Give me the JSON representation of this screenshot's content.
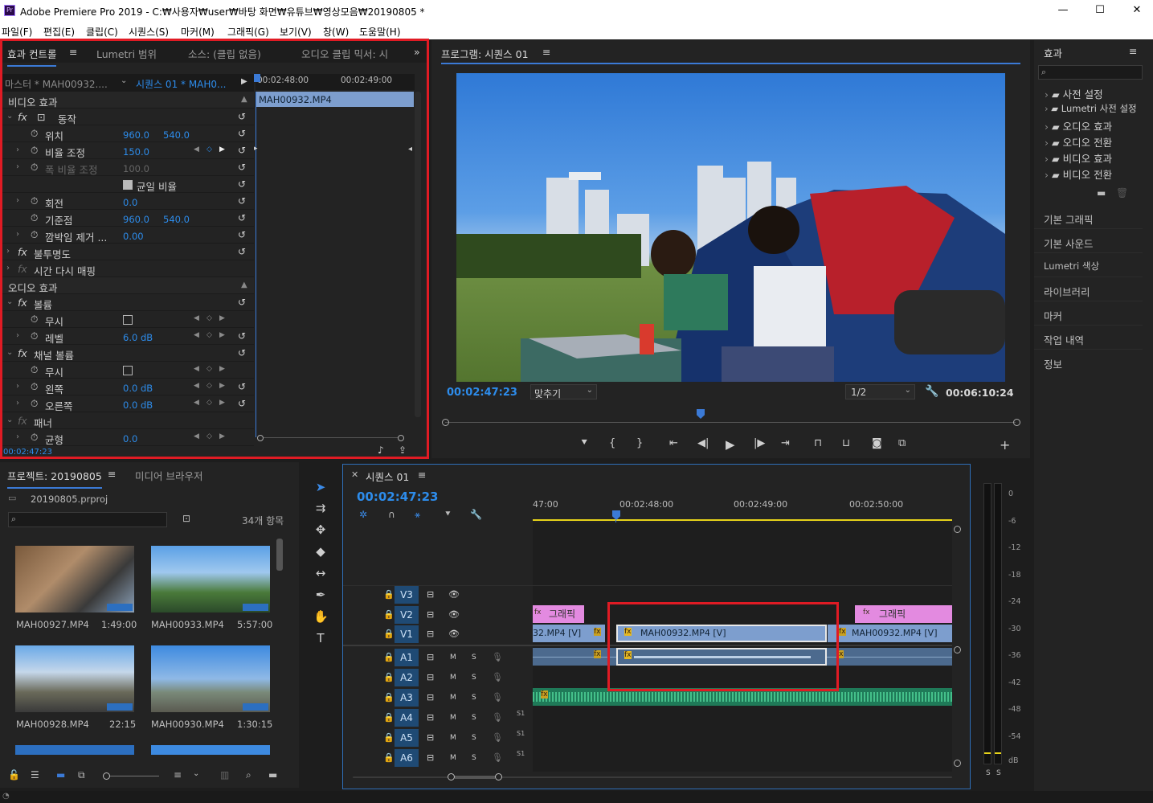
{
  "window": {
    "title": "Adobe Premiere Pro 2019 - C:₩사용자₩user₩바탕 화면₩유튜브₩영상모음₩20190805 *",
    "logo": "Pr",
    "minimize": "—",
    "maximize": "☐",
    "close": "✕"
  },
  "menu": [
    "파일(F)",
    "편집(E)",
    "클립(C)",
    "시퀀스(S)",
    "마커(M)",
    "그래픽(G)",
    "보기(V)",
    "창(W)",
    "도움말(H)"
  ],
  "effect_controls": {
    "tabs": [
      "효과 컨트롤",
      "Lumetri 범위",
      "소스: (클립 없음)",
      "오디오 클립 믹서: 시"
    ],
    "master": "마스터 * MAH00932....",
    "sequence": "시퀀스 01 * MAH0...",
    "ruler": [
      "00:02:48:00",
      "00:02:49:00"
    ],
    "clip": "MAH00932.MP4",
    "timecode": "00:02:47:23",
    "video_header": "비디오 효과",
    "audio_header": "오디오 효과",
    "motion": "동작",
    "position": {
      "label": "위치",
      "x": "960.0",
      "y": "540.0"
    },
    "scale": {
      "label": "비율 조정",
      "value": "150.0"
    },
    "scale_width": {
      "label": "폭 비율 조정",
      "value": "100.0"
    },
    "uniform": "균일 비율",
    "rotation": {
      "label": "회전",
      "value": "0.0"
    },
    "anchor": {
      "label": "기준점",
      "x": "960.0",
      "y": "540.0"
    },
    "flicker": {
      "label": "깜박임 제거 ...",
      "value": "0.00"
    },
    "opacity": "불투명도",
    "time_remap": "시간 다시 매핑",
    "volume": "볼륨",
    "bypass": "무시",
    "level": {
      "label": "레벨",
      "value": "6.0 dB"
    },
    "channel_volume": "채널 볼륨",
    "bypass2": "무시",
    "left": {
      "label": "왼쪽",
      "value": "0.0 dB"
    },
    "right": {
      "label": "오른쪽",
      "value": "0.0 dB"
    },
    "panner": "패너",
    "balance": {
      "label": "균형",
      "value": "0.0"
    }
  },
  "program": {
    "title": "프로그램: 시퀀스 01",
    "timecode": "00:02:47:23",
    "fit": "맞추기",
    "resolution": "1/2",
    "duration": "00:06:10:24"
  },
  "effects_panel": {
    "title": "효과",
    "search_placeholder": "",
    "items": [
      "사전 설정",
      "Lumetri 사전 설정",
      "오디오 효과",
      "오디오 전환",
      "비디오 효과",
      "비디오 전환"
    ]
  },
  "right_panels": [
    "기본 그래픽",
    "기본 사운드",
    "Lumetri 색상",
    "라이브러리",
    "마커",
    "작업 내역",
    "정보"
  ],
  "project": {
    "tabs": [
      "프로젝트: 20190805",
      "미디어 브라우저"
    ],
    "file": "20190805.prproj",
    "count": "34개 항목",
    "items": [
      {
        "name": "MAH00927.MP4",
        "dur": "1:49:00"
      },
      {
        "name": "MAH00933.MP4",
        "dur": "5:57:00"
      },
      {
        "name": "MAH00928.MP4",
        "dur": "22:15"
      },
      {
        "name": "MAH00930.MP4",
        "dur": "1:30:15"
      }
    ]
  },
  "timeline": {
    "tab": "시퀀스 01",
    "timecode": "00:02:47:23",
    "ruler": [
      "47:00",
      "00:02:48:00",
      "00:02:49:00",
      "00:02:50:00"
    ],
    "tracks": [
      "V3",
      "V2",
      "V1",
      "A1",
      "A2",
      "A3",
      "A4",
      "A5",
      "A6"
    ],
    "clips": {
      "v2_left": "그래픽",
      "v2_right": "그래픽",
      "v1_left": "32.MP4 [V]",
      "v1_mid": "MAH00932.MP4 [V]",
      "v1_right": "MAH00932.MP4 [V]"
    },
    "m": "M",
    "s": "S",
    "stereo": "S1"
  },
  "meter": {
    "labels": [
      "0",
      "-6",
      "-12",
      "-18",
      "-24",
      "-30",
      "-36",
      "-42",
      "-48",
      "-54",
      "dB"
    ],
    "solo": "S"
  }
}
